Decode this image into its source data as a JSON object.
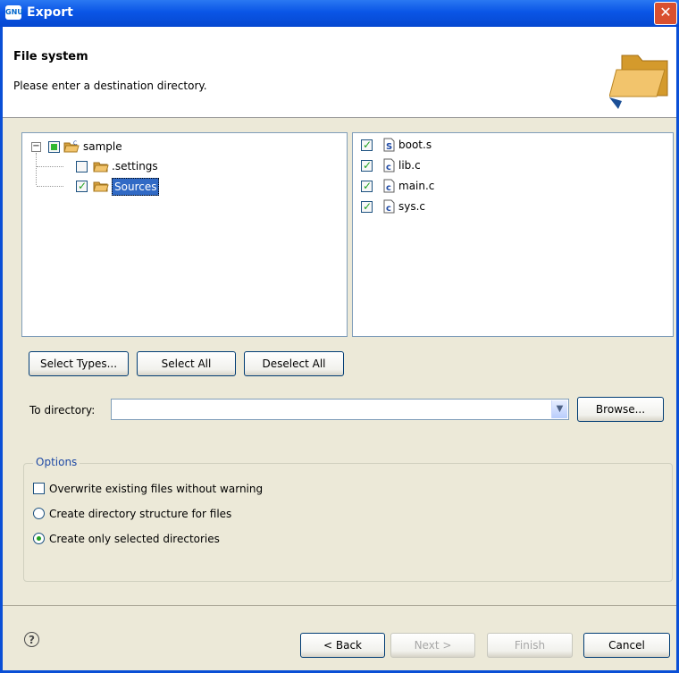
{
  "window": {
    "title": "Export",
    "app_icon": "gnu-icon"
  },
  "header": {
    "title": "File system",
    "description": "Please enter a destination directory.",
    "art_icon": "folder-open-icon"
  },
  "tree": [
    {
      "label": "sample",
      "checked": "partial",
      "expanded": true,
      "icon": "project-folder-icon"
    },
    {
      "label": ".settings",
      "checked": false,
      "icon": "folder-icon"
    },
    {
      "label": "Sources",
      "checked": true,
      "selected": true,
      "icon": "folder-icon"
    }
  ],
  "files": [
    {
      "label": "boot.s",
      "checked": true,
      "icon": "asm-file-icon",
      "badge": "S"
    },
    {
      "label": "lib.c",
      "checked": true,
      "icon": "c-file-icon",
      "badge": "c"
    },
    {
      "label": "main.c",
      "checked": true,
      "icon": "c-file-icon",
      "badge": "c"
    },
    {
      "label": "sys.c",
      "checked": true,
      "icon": "c-file-icon",
      "badge": "c"
    }
  ],
  "buttons": {
    "select_types": "Select Types...",
    "select_all": "Select All",
    "deselect_all": "Deselect All",
    "browse": "Browse...",
    "back": "< Back",
    "next": "Next >",
    "finish": "Finish",
    "cancel": "Cancel"
  },
  "to_directory": {
    "label": "To directory:",
    "value": ""
  },
  "options": {
    "title": "Options",
    "overwrite": "Overwrite existing files without warning",
    "create_structure": "Create directory structure for files",
    "create_selected": "Create only selected directories",
    "overwrite_checked": false,
    "selected_radio": "create_selected"
  },
  "colors": {
    "title_bar": "#0a55e6",
    "selection": "#316ac5",
    "checkmark": "#21a121"
  }
}
